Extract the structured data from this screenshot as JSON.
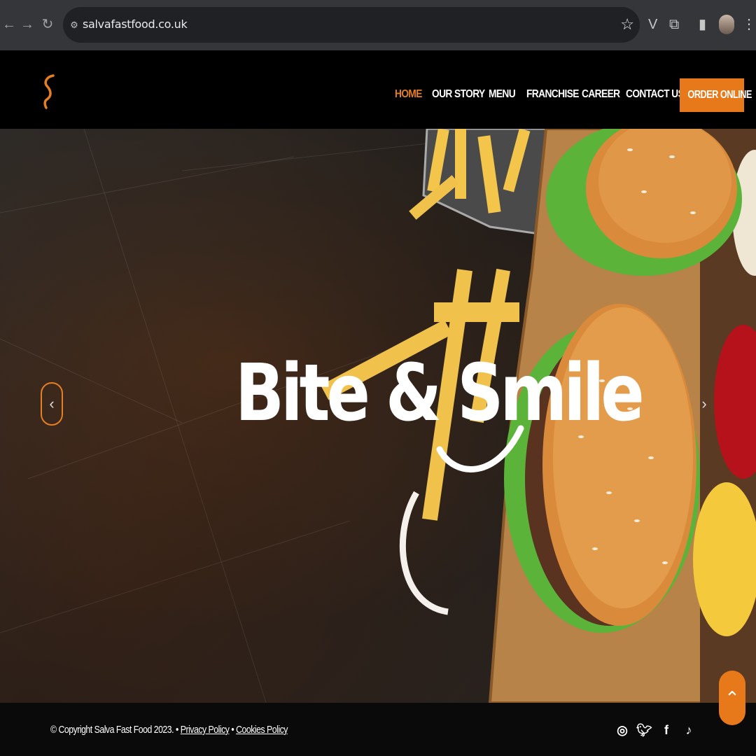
{
  "browser": {
    "url": "salvafastfood.co.uk",
    "back_icon": "back-arrow-icon",
    "forward_icon": "forward-arrow-icon",
    "reload_icon": "reload-icon"
  },
  "header": {
    "nav": [
      "HOME",
      "OUR STORY",
      "MENU",
      "FRANCHISE",
      "CAREER",
      "CONTACT US"
    ],
    "active_item": "HOME",
    "cta": "ORDER ONLINE",
    "accent_color": "#e8791a"
  },
  "hero": {
    "title": "Bite & Smile"
  },
  "footer": {
    "copyright": "© Copyright Salva Fast Food 2023.",
    "separator": "•",
    "privacy": "Privacy Policy",
    "cookies": "Cookies Policy",
    "social": [
      "instagram-icon",
      "twitter-icon",
      "facebook-icon",
      "tiktok-icon"
    ]
  }
}
